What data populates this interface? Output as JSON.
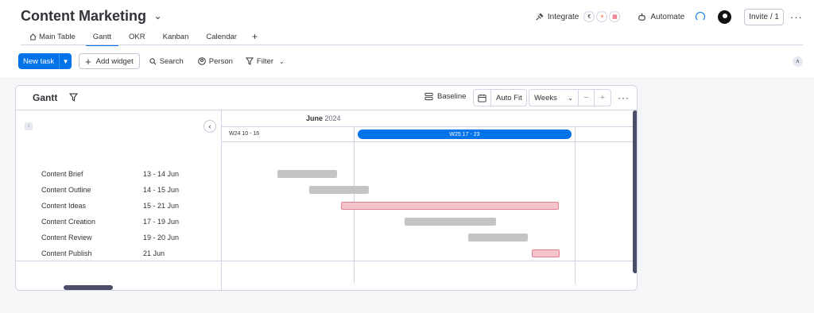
{
  "board": {
    "title": "Content Marketing"
  },
  "top_actions": {
    "integrate": "Integrate",
    "automate": "Automate",
    "invite": "Invite / 1"
  },
  "tabs": [
    {
      "label": "Main Table",
      "active": false
    },
    {
      "label": "Gantt",
      "active": true
    },
    {
      "label": "OKR",
      "active": false
    },
    {
      "label": "Kanban",
      "active": false
    },
    {
      "label": "Calendar",
      "active": false
    }
  ],
  "toolbar": {
    "new_task": "New task",
    "add_widget": "Add widget",
    "search": "Search",
    "person": "Person",
    "filter": "Filter"
  },
  "gantt": {
    "title": "Gantt",
    "baseline": "Baseline",
    "auto_fit": "Auto Fit",
    "scale": "Weeks",
    "month": "June",
    "year": "2024",
    "weeks": [
      {
        "label": "W24 10 - 16",
        "current": false
      },
      {
        "label": "W25 17 - 23",
        "current": true
      }
    ],
    "tasks": [
      {
        "name": "Content Brief",
        "dates": "13 - 14 Jun",
        "start": "2024-06-13",
        "end": "2024-06-14",
        "color": "#c4c4c4"
      },
      {
        "name": "Content Outline",
        "dates": "14 - 15 Jun",
        "start": "2024-06-14",
        "end": "2024-06-15",
        "color": "#c4c4c4"
      },
      {
        "name": "Content Ideas",
        "dates": "15 - 21 Jun",
        "start": "2024-06-15",
        "end": "2024-06-21",
        "color": "#f5c3cb"
      },
      {
        "name": "Content Creation",
        "dates": "17 - 19 Jun",
        "start": "2024-06-17",
        "end": "2024-06-19",
        "color": "#c4c4c4"
      },
      {
        "name": "Content Review",
        "dates": "19 - 20 Jun",
        "start": "2024-06-19",
        "end": "2024-06-20",
        "color": "#c4c4c4"
      },
      {
        "name": "Content Publish",
        "dates": "21 Jun",
        "start": "2024-06-21",
        "end": "2024-06-21",
        "color": "#f5c3cb"
      }
    ]
  }
}
